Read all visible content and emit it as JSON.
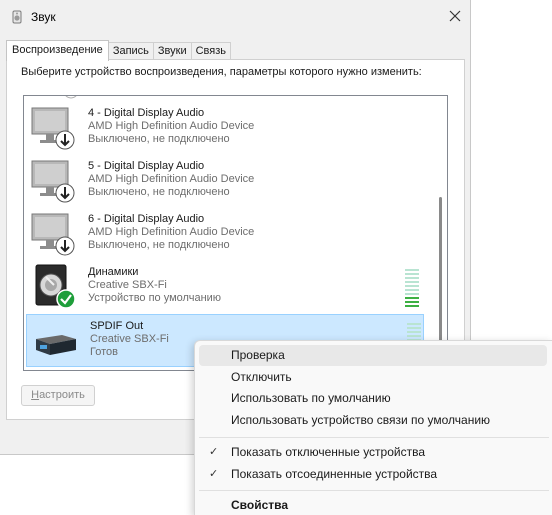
{
  "window": {
    "title": "Звук",
    "close_glyph": "✕"
  },
  "tabs": [
    {
      "label": "Воспроизведение",
      "active": true
    },
    {
      "label": "Запись",
      "active": false
    },
    {
      "label": "Звуки",
      "active": false
    },
    {
      "label": "Связь",
      "active": false
    }
  ],
  "instruction": "Выберите устройство воспроизведения, параметры которого нужно изменить:",
  "devices": [
    {
      "name": "4 - Digital Display Audio",
      "driver": "AMD High Definition Audio Device",
      "status": "Выключено, не подключено",
      "icon": "monitor-icon",
      "badge": "download-arrow-badge"
    },
    {
      "name": "5 - Digital Display Audio",
      "driver": "AMD High Definition Audio Device",
      "status": "Выключено, не подключено",
      "icon": "monitor-icon",
      "badge": "download-arrow-badge"
    },
    {
      "name": "6 - Digital Display Audio",
      "driver": "AMD High Definition Audio Device",
      "status": "Выключено, не подключено",
      "icon": "monitor-icon",
      "badge": "download-arrow-badge"
    },
    {
      "name": "Динамики",
      "driver": "Creative SBX-Fi",
      "status": "Устройство по умолчанию",
      "icon": "speaker-icon",
      "badge": "default-check-badge",
      "level": 0.15
    },
    {
      "name": "SPDIF Out",
      "driver": "Creative SBX-Fi",
      "status": "Готов",
      "icon": "spdif-device-icon",
      "selected": true,
      "level": 0
    }
  ],
  "buttons": {
    "configure": "Настроить",
    "configure_hotkey": "Н",
    "configure_rest": "астроить"
  },
  "context_menu": {
    "items": [
      {
        "label": "Проверка",
        "hover": true
      },
      {
        "label": "Отключить"
      },
      {
        "label": "Использовать по умолчанию"
      },
      {
        "label": "Использовать устройство связи по умолчанию"
      },
      {
        "label": "Показать отключенные устройства",
        "checked": true
      },
      {
        "label": "Показать отсоединенные устройства",
        "checked": true
      },
      {
        "label": "Свойства",
        "bold": true
      }
    ],
    "check_glyph": "✓"
  },
  "colors": {
    "selection_bg": "#cce8ff",
    "default_check": "#1e9e3a",
    "vu_inactive": "#b9e4d2",
    "vu_active": "#3cb043"
  }
}
